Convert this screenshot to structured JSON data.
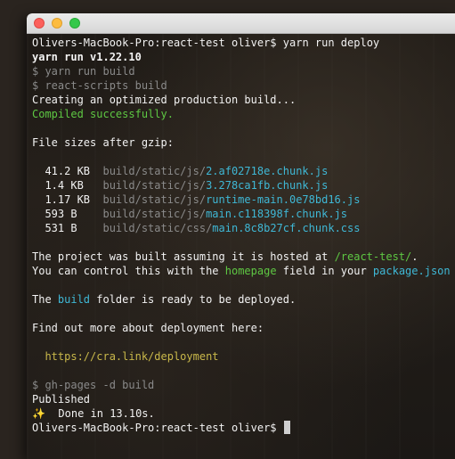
{
  "titlebar": {
    "buttons": [
      "close",
      "minimize",
      "maximize"
    ],
    "colors": {
      "close": "#fc605b",
      "minimize": "#fdbc40",
      "maximize": "#34c84a"
    }
  },
  "terminal": {
    "prompt": "Olivers-MacBook-Pro:react-test oliver$",
    "command": "yarn run deploy",
    "yarn_version": "yarn run v1.22.10",
    "step_build": "$ yarn run build",
    "step_react_scripts": "$ react-scripts build",
    "creating": "Creating an optimized production build...",
    "compiled": "Compiled successfully.",
    "file_sizes_header": "File sizes after gzip:",
    "files": [
      {
        "size": "41.2 KB",
        "dir": "build/static/js/",
        "name": "2.af02718e.chunk.js"
      },
      {
        "size": "1.4 KB",
        "dir": "build/static/js/",
        "name": "3.278ca1fb.chunk.js"
      },
      {
        "size": "1.17 KB",
        "dir": "build/static/js/",
        "name": "runtime-main.0e78bd16.js"
      },
      {
        "size": "593 B",
        "dir": "build/static/js/",
        "name": "main.c118398f.chunk.js"
      },
      {
        "size": "531 B",
        "dir": "build/static/css/",
        "name": "main.8c8b27cf.chunk.css"
      }
    ],
    "hosted_pre": "The project was built assuming it is hosted at ",
    "hosted_path": "/react-test/",
    "hosted_post": ".",
    "control_pre": "You can control this with the ",
    "control_homepage": "homepage",
    "control_mid": " field in your ",
    "control_pkg": "package.json",
    "control_post": ".",
    "ready_pre": "The ",
    "ready_build": "build",
    "ready_post": " folder is ready to be deployed.",
    "find_more": "Find out more about deployment here:",
    "deploy_link": "https://cra.link/deployment",
    "step_gh_pages": "$ gh-pages -d build",
    "published": "Published",
    "done": "✨  Done in 13.10s.",
    "final_prompt": "Olivers-MacBook-Pro:react-test oliver$ "
  }
}
